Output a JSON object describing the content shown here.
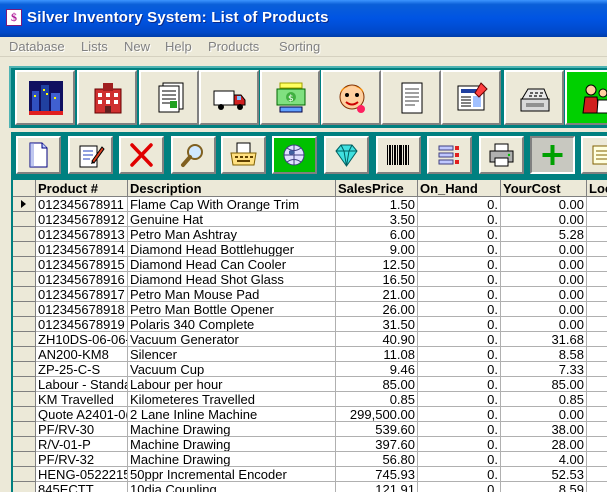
{
  "window": {
    "title": "Silver Inventory System: List of Products"
  },
  "menu": [
    "Database",
    "Lists",
    "New",
    "Help",
    "Products",
    "Sorting"
  ],
  "toolbar1": [
    {
      "icon": "city-icon"
    },
    {
      "icon": "building-icon"
    },
    {
      "icon": "documents-icon"
    },
    {
      "icon": "truck-icon"
    },
    {
      "icon": "money-icon"
    },
    {
      "icon": "character-icon"
    },
    {
      "icon": "page-icon"
    },
    {
      "icon": "newspaper-icon"
    },
    {
      "icon": "cash-register-icon"
    },
    {
      "icon": "people-icon"
    }
  ],
  "toolbar2": [
    {
      "icon": "new-document-icon"
    },
    {
      "icon": "edit-document-icon"
    },
    {
      "icon": "delete-icon"
    },
    {
      "icon": "search-icon"
    },
    {
      "icon": "typewriter-icon"
    },
    {
      "icon": "globe-icon"
    },
    {
      "icon": "diamond-icon"
    },
    {
      "icon": "barcode-icon"
    },
    {
      "icon": "list-icon"
    },
    {
      "icon": "printer-icon"
    },
    {
      "icon": "add-icon"
    },
    {
      "icon": "notes-icon"
    }
  ],
  "table": {
    "columns": [
      "Product #",
      "Description",
      "SalesPrice",
      "On_Hand",
      "YourCost",
      "Loc"
    ],
    "rows": [
      [
        "012345678911",
        "Flame Cap With Orange Trim",
        "1.50",
        "0.",
        "0.00"
      ],
      [
        "012345678912",
        "Genuine Hat",
        "3.50",
        "0.",
        "0.00"
      ],
      [
        "012345678913",
        "Petro Man Ashtray",
        "6.00",
        "0.",
        "5.28"
      ],
      [
        "012345678914",
        "Diamond Head Bottlehugger",
        "9.00",
        "0.",
        "0.00"
      ],
      [
        "012345678915",
        "Diamond Head Can Cooler",
        "12.50",
        "0.",
        "0.00"
      ],
      [
        "012345678916",
        "Diamond Head Shot Glass",
        "16.50",
        "0.",
        "0.00"
      ],
      [
        "012345678917",
        "Petro Man Mouse Pad",
        "21.00",
        "0.",
        "0.00"
      ],
      [
        "012345678918",
        "Petro Man Bottle Opener",
        "26.00",
        "0.",
        "0.00"
      ],
      [
        "012345678919",
        "Polaris 340  Complete",
        "31.50",
        "0.",
        "0.00"
      ],
      [
        "ZH10DS-06-06-",
        "Vacuum Generator",
        "40.90",
        "0.",
        "31.68"
      ],
      [
        "AN200-KM8",
        "Silencer",
        "11.08",
        "0.",
        "8.58"
      ],
      [
        "ZP-25-C-S",
        "Vacuum Cup",
        "9.46",
        "0.",
        "7.33"
      ],
      [
        "Labour - Standa",
        "Labour per hour",
        "85.00",
        "0.",
        "85.00"
      ],
      [
        "KM Travelled",
        "Kilometeres Travelled",
        "0.85",
        "0.",
        "0.85"
      ],
      [
        "Quote A2401-0(",
        "2 Lane Inline Machine",
        "299,500.00",
        "0.",
        "0.00"
      ],
      [
        "PF/RV-30",
        "Machine Drawing",
        "539.60",
        "0.",
        "38.00"
      ],
      [
        "R/V-01-P",
        "Machine Drawing",
        "397.60",
        "0.",
        "28.00"
      ],
      [
        "PF/RV-32",
        "Machine Drawing",
        "56.80",
        "0.",
        "4.00"
      ],
      [
        "HENG-0522215",
        "50ppr Incremental Encoder",
        "745.93",
        "0.",
        "52.53"
      ],
      [
        "845ECTT",
        "10dia Coupling",
        "121.91",
        "0.",
        "8.59"
      ]
    ]
  }
}
